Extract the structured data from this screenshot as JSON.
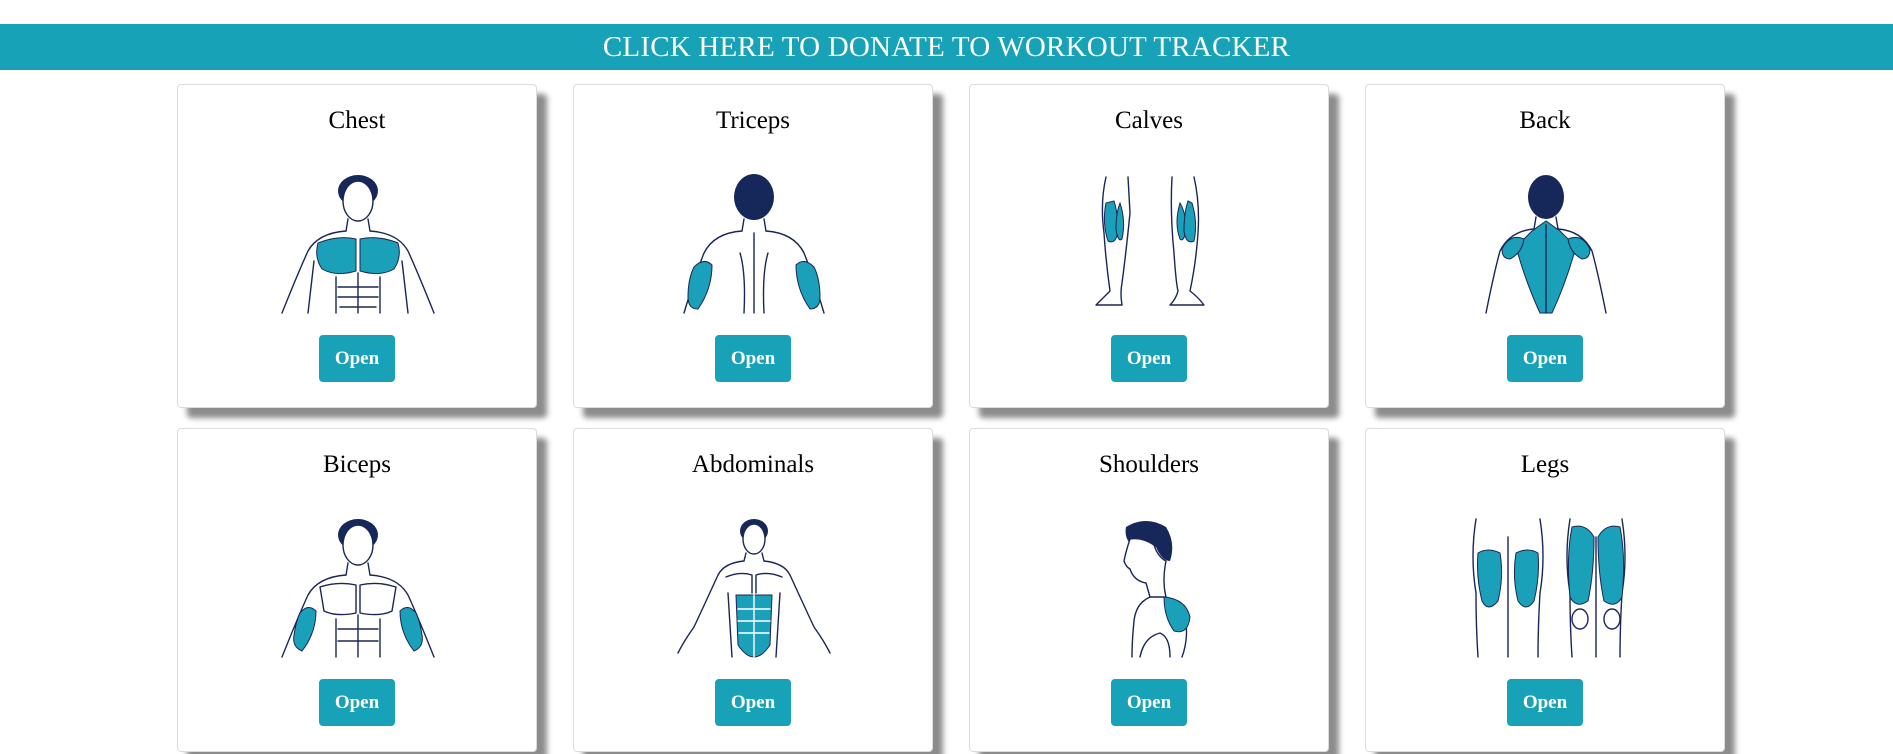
{
  "banner": {
    "text": "CLICK HERE TO DONATE TO WORKOUT TRACKER"
  },
  "accent_color": "#17a2b8",
  "muscle_groups": [
    {
      "title": "Chest",
      "button": "Open",
      "icon": "chest-front-figure-icon"
    },
    {
      "title": "Triceps",
      "button": "Open",
      "icon": "triceps-back-figure-icon"
    },
    {
      "title": "Calves",
      "button": "Open",
      "icon": "calves-legs-figure-icon"
    },
    {
      "title": "Back",
      "button": "Open",
      "icon": "back-figure-icon"
    },
    {
      "title": "Biceps",
      "button": "Open",
      "icon": "biceps-front-figure-icon"
    },
    {
      "title": "Abdominals",
      "button": "Open",
      "icon": "abdominals-figure-icon"
    },
    {
      "title": "Shoulders",
      "button": "Open",
      "icon": "shoulders-side-figure-icon"
    },
    {
      "title": "Legs",
      "button": "Open",
      "icon": "legs-figure-icon"
    }
  ]
}
